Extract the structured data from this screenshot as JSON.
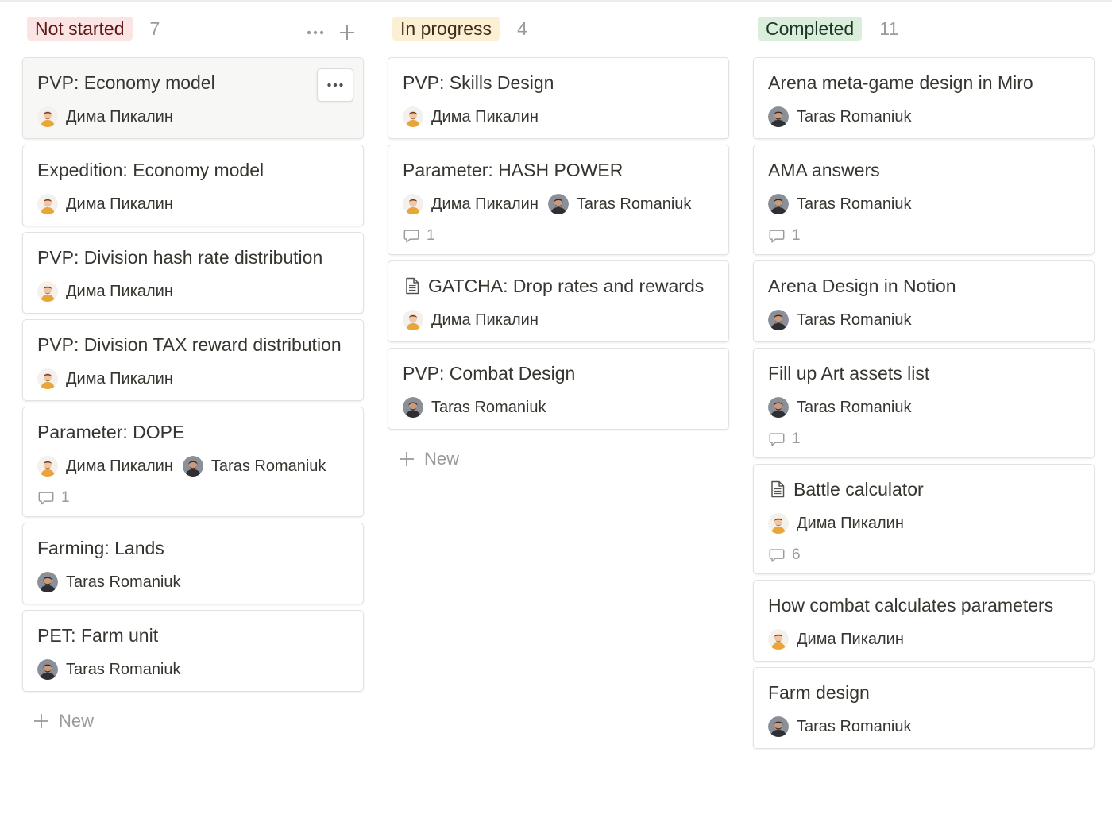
{
  "columns": [
    {
      "status": "Not started",
      "count": "7",
      "cards": [
        {
          "title": "PVP: Economy model",
          "people": [
            "Дима Пикалин"
          ],
          "comments": ""
        },
        {
          "title": "Expedition: Economy model",
          "people": [
            "Дима Пикалин"
          ],
          "comments": ""
        },
        {
          "title": "PVP: Division hash rate distribution",
          "people": [
            "Дима Пикалин"
          ],
          "comments": ""
        },
        {
          "title": "PVP: Division TAX reward distribution",
          "people": [
            "Дима Пикалин"
          ],
          "comments": ""
        },
        {
          "title": "Parameter: DOPE",
          "people": [
            "Дима Пикалин",
            "Taras Romaniuk"
          ],
          "comments": "1"
        },
        {
          "title": "Farming: Lands",
          "people": [
            "Taras Romaniuk"
          ],
          "comments": ""
        },
        {
          "title": "PET: Farm unit",
          "people": [
            "Taras Romaniuk"
          ],
          "comments": ""
        }
      ],
      "new_label": "New"
    },
    {
      "status": "In progress",
      "count": "4",
      "cards": [
        {
          "title": "PVP: Skills Design",
          "people": [
            "Дима Пикалин"
          ],
          "comments": ""
        },
        {
          "title": "Parameter: HASH POWER",
          "people": [
            "Дима Пикалин",
            "Taras Romaniuk"
          ],
          "comments": "1"
        },
        {
          "title": "GATCHA: Drop rates and rewards",
          "people": [
            "Дима Пикалин"
          ],
          "comments": ""
        },
        {
          "title": "PVP: Combat Design",
          "people": [
            "Taras Romaniuk"
          ],
          "comments": ""
        }
      ],
      "new_label": "New"
    },
    {
      "status": "Completed",
      "count": "11",
      "cards": [
        {
          "title": "Arena meta-game design in Miro",
          "people": [
            "Taras Romaniuk"
          ],
          "comments": ""
        },
        {
          "title": "AMA answers",
          "people": [
            "Taras Romaniuk"
          ],
          "comments": "1"
        },
        {
          "title": "Arena Design in Notion",
          "people": [
            "Taras Romaniuk"
          ],
          "comments": ""
        },
        {
          "title": "Fill up Art assets list",
          "people": [
            "Taras Romaniuk"
          ],
          "comments": "1"
        },
        {
          "title": "Battle calculator",
          "people": [
            "Дима Пикалин"
          ],
          "comments": "6"
        },
        {
          "title": "How combat calculates parameters",
          "people": [
            "Дима Пикалин"
          ],
          "comments": ""
        },
        {
          "title": "Farm design",
          "people": [
            "Taras Romaniuk"
          ],
          "comments": ""
        }
      ]
    }
  ],
  "colors": {
    "not_started_bg": "#fbe4e4",
    "in_progress_bg": "#fbf0d3",
    "completed_bg": "#dbeddb",
    "muted_text": "#9b9a97"
  },
  "icons": {
    "header_more": "more-horizontal-icon",
    "header_add": "plus-icon",
    "doc": "document-icon",
    "comment": "comment-icon",
    "card_menu": "more-horizontal-icon"
  }
}
